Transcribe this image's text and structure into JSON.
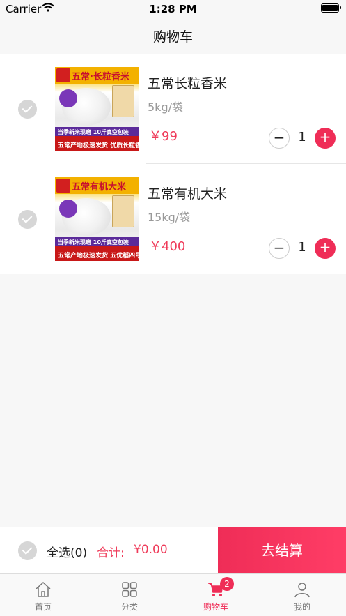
{
  "status_bar": {
    "carrier": "Carrier",
    "time": "1:28 PM"
  },
  "nav": {
    "title": "购物车"
  },
  "cart": {
    "items": [
      {
        "name": "五常长粒香米",
        "spec": "5kg/袋",
        "price": "￥99",
        "quantity": "1",
        "image_text": {
          "top": "五常·长粒香米",
          "band1": "当季新米现磨  10斤真空包装",
          "band2": "五常产地极速发货  优质长粒香"
        }
      },
      {
        "name": "五常有机大米",
        "spec": "15kg/袋",
        "price": "￥400",
        "quantity": "1",
        "image_text": {
          "top": "五常有机大米",
          "band1": "当季新米现磨  10斤真空包装",
          "band2": "五常产地极速发货  五优稻四号"
        }
      }
    ],
    "minus_label": "−",
    "plus_label": "+"
  },
  "checkout": {
    "select_all_label": "全选(0)",
    "total_label": "合计:",
    "total_value": "¥0.00",
    "button_label": "去结算"
  },
  "tabs": [
    {
      "label": "首页",
      "icon": "home-icon"
    },
    {
      "label": "分类",
      "icon": "grid-icon"
    },
    {
      "label": "购物车",
      "icon": "cart-icon",
      "badge": "2",
      "active": true
    },
    {
      "label": "我的",
      "icon": "user-icon"
    }
  ],
  "colors": {
    "accent": "#ef2d57",
    "price": "#ef3b5a"
  }
}
